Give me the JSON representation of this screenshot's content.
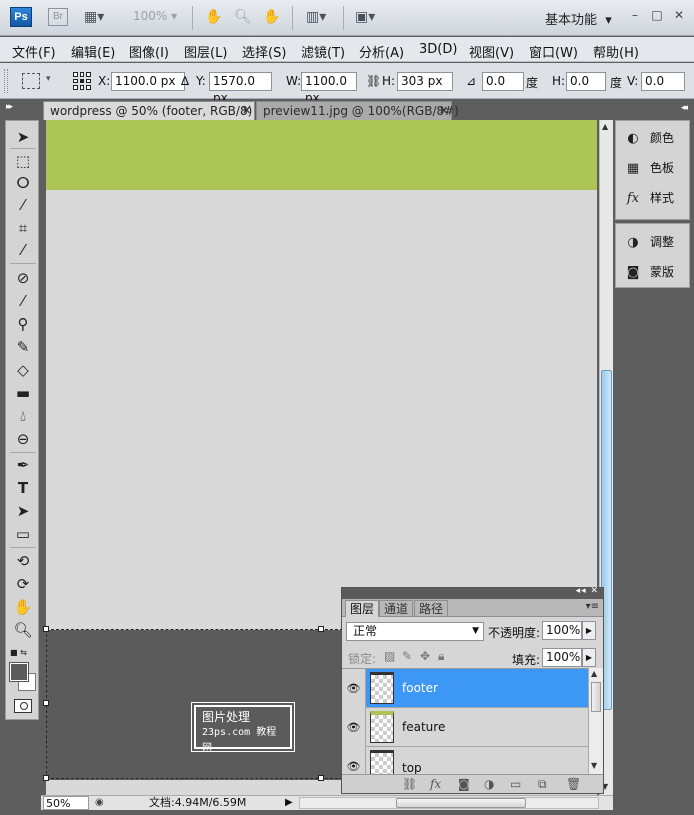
{
  "appbar": {
    "logo": "Ps",
    "bridge": "Br",
    "zoom": "100%",
    "workspace": "基本功能",
    "icons": [
      "film-icon",
      "hand-icon",
      "zoom-icon",
      "rotate-icon",
      "arrange-icon",
      "screen-mode-icon"
    ]
  },
  "menu": [
    "文件(F)",
    "编辑(E)",
    "图像(I)",
    "图层(L)",
    "选择(S)",
    "滤镜(T)",
    "分析(A)",
    "3D(D)",
    "视图(V)",
    "窗口(W)",
    "帮助(H)"
  ],
  "options": {
    "x_label": "X:",
    "x_value": "1100.0 px",
    "y_label": "Y:",
    "y_value": "1570.0 px",
    "w_label": "W:",
    "w_value": "1100.0 px",
    "h_label": "H:",
    "h_value": "303 px",
    "angle_value": "0.0",
    "angle_unit": "度",
    "hskew_label": "H:",
    "hskew_value": "0.0",
    "hskew_unit": "度",
    "vskew_label": "V:",
    "vskew_value": "0.0"
  },
  "tabs": [
    {
      "label": "wordpress @ 50% (footer, RGB/8) *",
      "active": true
    },
    {
      "label": "preview11.jpg @ 100%(RGB/8#)",
      "active": false
    }
  ],
  "dock": {
    "group1": [
      {
        "label": "颜色",
        "icon": "color-icon"
      },
      {
        "label": "色板",
        "icon": "swatches-icon"
      },
      {
        "label": "样式",
        "icon": "styles-icon"
      }
    ],
    "group2": [
      {
        "label": "调整",
        "icon": "adjustments-icon"
      },
      {
        "label": "蒙版",
        "icon": "masks-icon"
      }
    ]
  },
  "canvas": {
    "watermark_line1": "图片处理",
    "watermark_line2": "23ps.com",
    "watermark_line3": "教程网"
  },
  "status": {
    "zoom": "50%",
    "doc": "文档:4.94M/6.59M"
  },
  "layers_panel": {
    "tabs": [
      "图层",
      "通道",
      "路径"
    ],
    "blend_mode": "正常",
    "opacity_label": "不透明度:",
    "opacity": "100%",
    "lock_label": "锁定:",
    "fill_label": "填充:",
    "fill": "100%",
    "layers": [
      {
        "name": "footer",
        "selected": true
      },
      {
        "name": "feature",
        "selected": false
      },
      {
        "name": "top",
        "selected": false
      }
    ]
  },
  "colors": {
    "green_band": "#adc457",
    "selected_layer": "#3d97f5",
    "footer_fill": "#5b5b5b"
  }
}
